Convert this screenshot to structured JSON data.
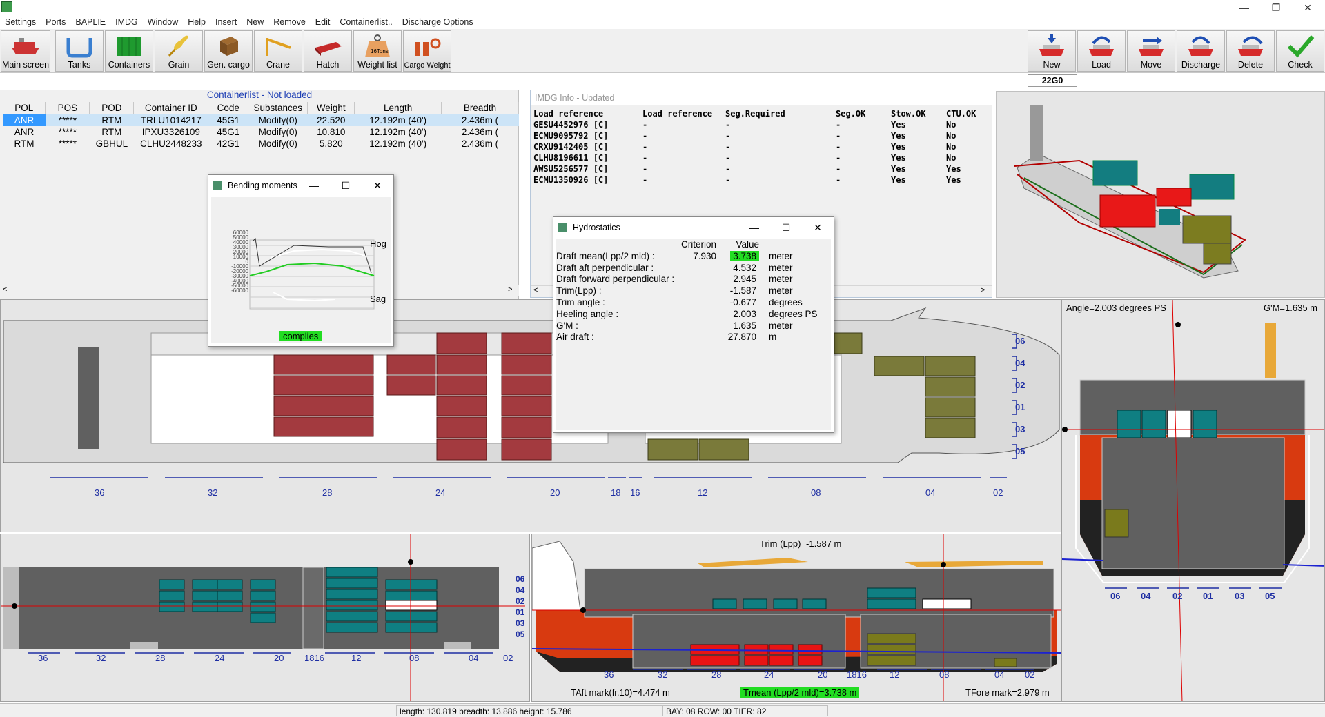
{
  "menu": [
    "Settings",
    "Ports",
    "BAPLIE",
    "IMDG",
    "Window",
    "Help",
    "Insert",
    "New",
    "Remove",
    "Edit",
    "Containerlist..",
    "Discharge Options"
  ],
  "toolbar_left": [
    "Main screen",
    "Tanks",
    "Containers",
    "Grain",
    "Gen. cargo",
    "Crane",
    "Hatch",
    "Weight list",
    "Cargo Weight"
  ],
  "toolbar_right": [
    "New",
    "Load",
    "Move",
    "Discharge",
    "Delete",
    "Check"
  ],
  "weight_icon_text": "16Tons",
  "counter": "22G0",
  "containerlist": {
    "title": "Containerlist - Not loaded",
    "columns": [
      "POL",
      "POS",
      "POD",
      "Container ID",
      "Code",
      "Substances",
      "Weight",
      "Length",
      "Breadth"
    ],
    "rows": [
      [
        "ANR",
        "*****",
        "RTM",
        "TRLU1014217",
        "45G1",
        "Modify(0)",
        "22.520",
        "12.192m (40')",
        "2.436m ("
      ],
      [
        "ANR",
        "*****",
        "RTM",
        "IPXU3326109",
        "45G1",
        "Modify(0)",
        "10.810",
        "12.192m (40')",
        "2.436m ("
      ],
      [
        "RTM",
        "*****",
        "GBHUL",
        "CLHU2448233",
        "42G1",
        "Modify(0)",
        "5.820",
        "12.192m (40')",
        "2.436m ("
      ]
    ]
  },
  "imdg": {
    "title": "IMDG Info - Updated",
    "columns": [
      "Load reference",
      "Load reference",
      "Seg.Required",
      "Seg.OK",
      "Stow.OK",
      "CTU.OK"
    ],
    "rows": [
      [
        "GESU4452976 [C]",
        "-",
        "-",
        "-",
        "Yes",
        "No"
      ],
      [
        "ECMU9095792 [C]",
        "-",
        "-",
        "-",
        "Yes",
        "No"
      ],
      [
        "CRXU9142405 [C]",
        "-",
        "-",
        "-",
        "Yes",
        "No"
      ],
      [
        "CLHU8196611 [C]",
        "-",
        "-",
        "-",
        "Yes",
        "No"
      ],
      [
        "AWSU5256577 [C]",
        "-",
        "-",
        "-",
        "Yes",
        "Yes"
      ],
      [
        "ECMU1350926 [C]",
        "-",
        "-",
        "-",
        "Yes",
        "Yes"
      ]
    ]
  },
  "bending": {
    "title": "Bending moments",
    "hog": "Hog",
    "sag": "Sag",
    "status": "complies",
    "yticks": [
      "60000",
      "50000",
      "40000",
      "30000",
      "20000",
      "10000",
      "0",
      "-10000",
      "-20000",
      "-30000",
      "-40000",
      "-50000",
      "-60000"
    ]
  },
  "hydro": {
    "title": "Hydrostatics",
    "header_criterion": "Criterion",
    "header_value": "Value",
    "rows": [
      {
        "label": "Draft mean(Lpp/2 mld) :",
        "criterion": "7.930",
        "value": "3.738",
        "unit": "meter"
      },
      {
        "label": "Draft aft perpendicular :",
        "criterion": "",
        "value": "4.532",
        "unit": "meter"
      },
      {
        "label": "Draft forward perpendicular :",
        "criterion": "",
        "value": "2.945",
        "unit": "meter"
      },
      {
        "label": "Trim(Lpp) :",
        "criterion": "",
        "value": "-1.587",
        "unit": "meter"
      },
      {
        "label": "Trim angle :",
        "criterion": "",
        "value": "-0.677",
        "unit": "degrees"
      },
      {
        "label": "Heeling angle :",
        "criterion": "",
        "value": "2.003",
        "unit": "degrees PS"
      },
      {
        "label": "G'M :",
        "criterion": "",
        "value": "1.635",
        "unit": "meter"
      },
      {
        "label": "Air draft :",
        "criterion": "",
        "value": "27.870",
        "unit": "m"
      }
    ]
  },
  "topview": {
    "bays": [
      "36",
      "32",
      "28",
      "24",
      "20",
      "18",
      "16",
      "12",
      "08",
      "04",
      "02"
    ],
    "rows": [
      "06",
      "04",
      "02",
      "01",
      "03",
      "05"
    ]
  },
  "planview": {
    "bays": [
      "36",
      "32",
      "28",
      "24",
      "20",
      "1816",
      "12",
      "08",
      "04",
      "02"
    ],
    "rows": [
      "06",
      "04",
      "02",
      "01",
      "03",
      "05"
    ]
  },
  "sideview": {
    "trim": "Trim (Lpp)=-1.587 m",
    "taft": "TAft mark(fr.10)=4.474 m",
    "tmean": "Tmean (Lpp/2 mld)=3.738 m",
    "tfore": "TFore mark=2.979 m",
    "bays": [
      "36",
      "32",
      "28",
      "24",
      "20",
      "1816",
      "12",
      "08",
      "04",
      "02"
    ]
  },
  "crossview": {
    "angle": "Angle=2.003 degrees PS",
    "gm": "G'M=1.635 m",
    "rows": [
      "06",
      "04",
      "02",
      "01",
      "03",
      "05"
    ]
  },
  "status": {
    "dims": "length: 130.819 breadth: 13.886 height: 15.786",
    "pos": "BAY: 08 ROW: 00 TIER: 82"
  },
  "colors": {
    "red_cargo": "#a6343a",
    "olive_cargo": "#7a7a3a",
    "teal": "#0f7f82",
    "hull_red": "#d83a10",
    "green": "#22dd22"
  }
}
